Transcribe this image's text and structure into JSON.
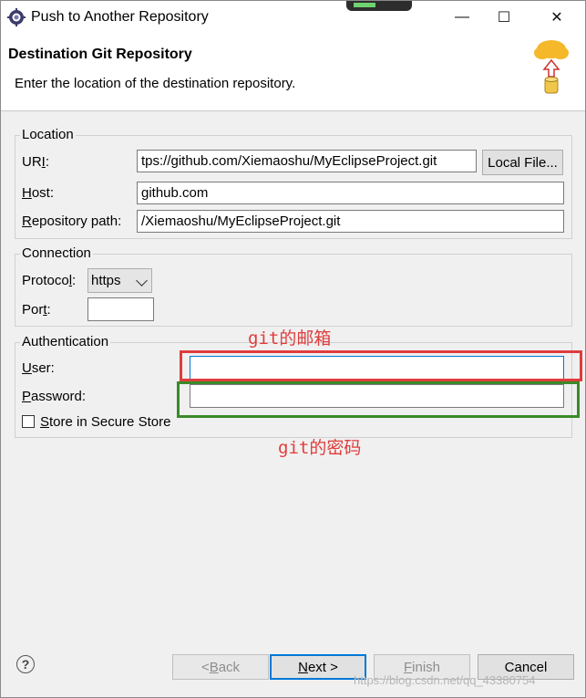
{
  "window": {
    "title": "Push to Another Repository",
    "minimize_label": "—",
    "maximize_label": "☐",
    "close_label": "✕"
  },
  "banner": {
    "title": "Destination Git Repository",
    "description": "Enter the location of the destination repository.",
    "icon": "git-cloud-push-icon"
  },
  "location": {
    "group_label": "Location",
    "uri_label_prefix": "UR",
    "uri_label_mnemonic": "I",
    "uri_label_suffix": ":",
    "uri_value": "tps://github.com/Xiemaoshu/MyEclipseProject.git",
    "local_file_button": "Local File...",
    "host_label_mnemonic": "H",
    "host_label_rest": "ost:",
    "host_value": "github.com",
    "repo_path_label_mnemonic": "R",
    "repo_path_label_rest": "epository path:",
    "repo_path_value": "/Xiemaoshu/MyEclipseProject.git"
  },
  "connection": {
    "group_label": "Connection",
    "protocol_label_prefix": "Protoco",
    "protocol_label_mnemonic": "l",
    "protocol_label_suffix": ":",
    "protocol_value": "https",
    "port_label_prefix": "Por",
    "port_label_mnemonic": "t",
    "port_label_suffix": ":",
    "port_value": ""
  },
  "authentication": {
    "group_label": "Authentication",
    "user_label_mnemonic": "U",
    "user_label_rest": "ser:",
    "user_value": "",
    "password_label_mnemonic": "P",
    "password_label_rest": "assword:",
    "password_value": "",
    "store_checkbox_mnemonic": "S",
    "store_checkbox_rest": "tore in Secure Store",
    "store_checked": false
  },
  "annotations": {
    "user_note": "git的邮箱",
    "password_note": "git的密码",
    "user_color": "#e03c3c",
    "password_color": "#3a8a2a"
  },
  "footer": {
    "back_prefix": "< ",
    "back_mnemonic": "B",
    "back_rest": "ack",
    "next_mnemonic": "N",
    "next_rest": "ext >",
    "finish_mnemonic": "F",
    "finish_rest": "inish",
    "cancel_label": "Cancel",
    "help_label": "?"
  },
  "watermark": "https://blog.csdn.net/qq_43380754"
}
